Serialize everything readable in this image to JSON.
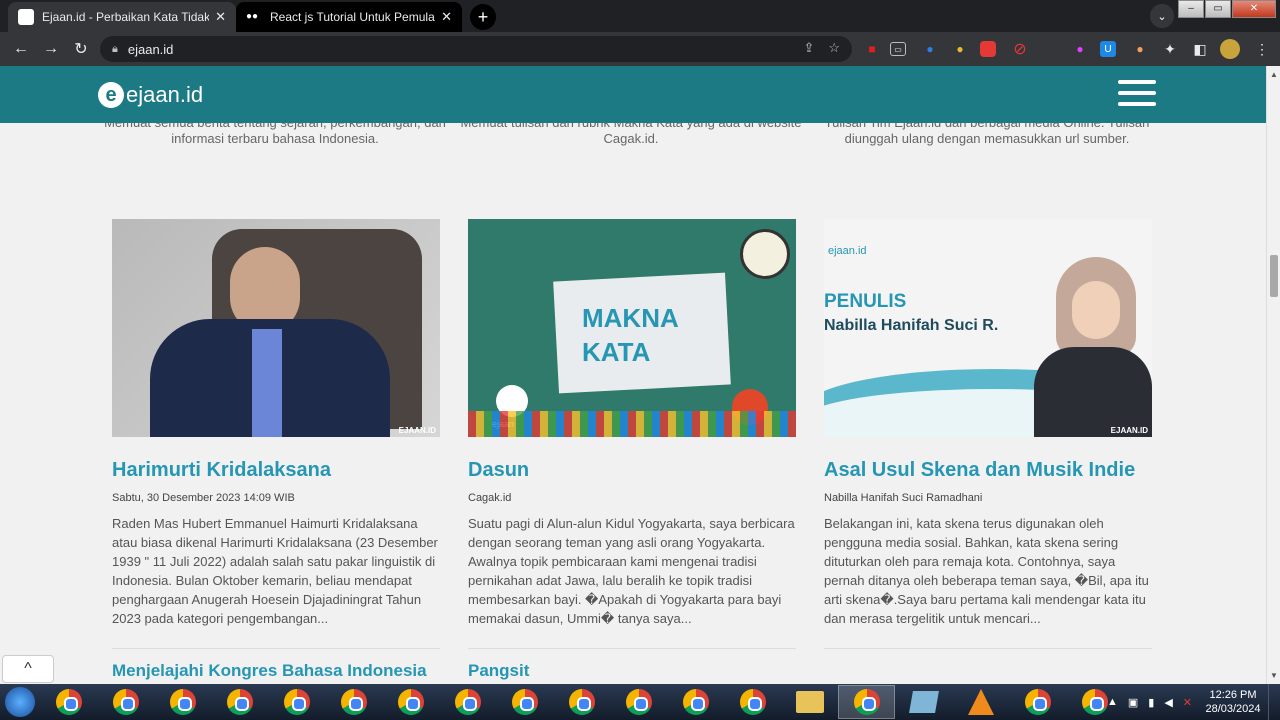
{
  "browser": {
    "tabs": [
      {
        "title": "Ejaan.id - Perbaikan Kata Tidak Baku",
        "active": true
      },
      {
        "title": "React js Tutorial Untuk Pemula. Sebua",
        "active": false
      }
    ],
    "new_tab": "+",
    "tab_menu": "⌄",
    "url": "ejaan.id"
  },
  "site": {
    "logo_text": "ejaan.id",
    "top_snippets": [
      "Memuat semua berita tentang sejarah, perkembangan, dan informasi terbaru bahasa Indonesia.",
      "Memuat tulisan dari rubrik Makna Kata yang ada di website Cagak.id.",
      "Tulisan Tim Ejaan.id dari berbagai media Online. Tulisan diunggah ulang dengan memasukkan url sumber."
    ],
    "cards": [
      {
        "title": "Harimurti Kridalaksana",
        "meta": "Sabtu, 30 Desember 2023 14:09 WIB",
        "excerpt": "Raden Mas Hubert Emmanuel Haimurti Kridalaksana atau biasa dikenal Harimurti Kridalaksana (23 Desember 1939 \" 11 Juli 2022) adalah salah satu pakar linguistik di Indonesia. Bulan Oktober kemarin, beliau mendapat penghargaan Anugerah Hoesein Djajadiningrat Tahun 2023 pada kategori pengembangan...",
        "watermark": "EJAAN.ID",
        "next_title": "Menjelajahi Kongres Bahasa Indonesia"
      },
      {
        "title": "Dasun",
        "meta": "Cagak.id",
        "excerpt": "Suatu pagi di Alun-alun Kidul Yogyakarta, saya berbicara dengan seorang teman yang asli orang Yogyakarta. Awalnya topik pembicaraan kami mengenai tradisi pernikahan adat Jawa, lalu beralih ke topik tradisi membesarkan bayi. �Apakah di Yogyakarta para bayi memakai dasun, Ummi� tanya saya...",
        "image_text_1": "MAKNA",
        "image_text_2": "KATA",
        "image_logo": "ejaan",
        "next_title": "Pangsit"
      },
      {
        "title": "Asal Usul Skena dan Musik Indie",
        "meta": "Nabilla Hanifah Suci Ramadhani",
        "excerpt": "Belakangan ini, kata skena terus digunakan oleh pengguna media sosial. Bahkan, kata skena sering dituturkan oleh para remaja kota. Contohnya, saya pernah ditanya oleh beberapa teman saya, �Bil, apa itu arti skena�.Saya baru pertama kali mendengar kata itu dan merasa tergelitik untuk mencari...",
        "image_logo": "ejaan.id",
        "image_text_1": "PENULIS",
        "image_text_2": "Nabilla Hanifah Suci R.",
        "watermark": "EJAAN.ID"
      }
    ],
    "back_to_top": "^"
  },
  "taskbar": {
    "time": "12:26 PM",
    "date": "28/03/2024"
  },
  "colors": {
    "header": "#1b7a84",
    "title": "#2596b4"
  }
}
